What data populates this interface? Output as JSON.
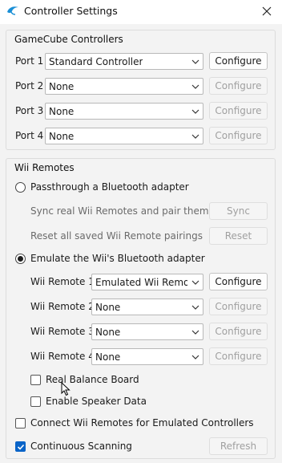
{
  "window": {
    "title": "Controller Settings"
  },
  "gamecube": {
    "group_title": "GameCube Controllers",
    "ports": [
      {
        "label": "Port 1",
        "value": "Standard Controller",
        "configure": "Configure",
        "configure_enabled": true
      },
      {
        "label": "Port 2",
        "value": "None",
        "configure": "Configure",
        "configure_enabled": false
      },
      {
        "label": "Port 3",
        "value": "None",
        "configure": "Configure",
        "configure_enabled": false
      },
      {
        "label": "Port 4",
        "value": "None",
        "configure": "Configure",
        "configure_enabled": false
      }
    ]
  },
  "wii": {
    "group_title": "Wii Remotes",
    "passthrough": {
      "label": "Passthrough a Bluetooth adapter",
      "selected": false,
      "sync_text": "Sync real Wii Remotes and pair them",
      "sync_button": "Sync",
      "reset_text": "Reset all saved Wii Remote pairings",
      "reset_button": "Reset"
    },
    "emulate": {
      "label": "Emulate the Wii's Bluetooth adapter",
      "selected": true
    },
    "remotes": [
      {
        "label": "Wii Remote 1",
        "value": "Emulated Wii Remote",
        "configure": "Configure",
        "configure_enabled": true
      },
      {
        "label": "Wii Remote 2",
        "value": "None",
        "configure": "Configure",
        "configure_enabled": false
      },
      {
        "label": "Wii Remote 3",
        "value": "None",
        "configure": "Configure",
        "configure_enabled": false
      },
      {
        "label": "Wii Remote 4",
        "value": "None",
        "configure": "Configure",
        "configure_enabled": false
      }
    ],
    "real_balance_board": {
      "label": "Real Balance Board",
      "checked": false
    },
    "speaker_data": {
      "label": "Enable Speaker Data",
      "checked": false
    },
    "connect_emulated": {
      "label": "Connect Wii Remotes for Emulated Controllers",
      "checked": false
    },
    "continuous_scanning": {
      "label": "Continuous Scanning",
      "checked": true
    },
    "refresh_button": "Refresh"
  },
  "colors": {
    "accent": "#0a64c8",
    "app_icon": "#1a8fd6",
    "disabled_text": "#a0a0a0"
  }
}
